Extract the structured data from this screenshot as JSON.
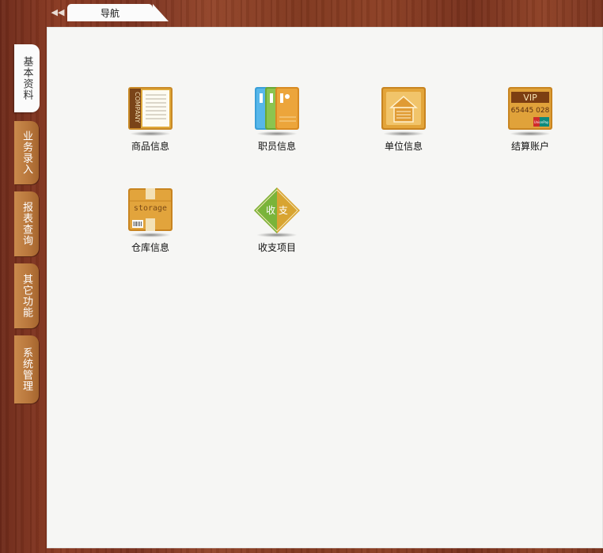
{
  "header": {
    "collapse_glyph": "◀◀",
    "nav_tab_label": "导航"
  },
  "sidebar": {
    "tabs": [
      {
        "label": "基本资料",
        "active": true
      },
      {
        "label": "业务录入",
        "active": false
      },
      {
        "label": "报表查询",
        "active": false
      },
      {
        "label": "其它功能",
        "active": false
      },
      {
        "label": "系统管理",
        "active": false
      }
    ]
  },
  "main": {
    "tiles": [
      {
        "label": "商品信息",
        "icon": "company-book-icon",
        "icon_text": "COMPANY"
      },
      {
        "label": "职员信息",
        "icon": "staff-cards-icon"
      },
      {
        "label": "单位信息",
        "icon": "warehouse-unit-icon"
      },
      {
        "label": "结算账户",
        "icon": "vip-card-icon",
        "icon_text": "VIP",
        "icon_number": "65445 028",
        "icon_brand": "UnionPay"
      },
      {
        "label": "仓库信息",
        "icon": "storage-box-icon",
        "icon_text": "storage"
      },
      {
        "label": "收支项目",
        "icon": "income-expense-diamond-icon",
        "icon_text": "收 支"
      }
    ]
  },
  "colors": {
    "wood": "#80381f",
    "tab_orange": "#b8773c",
    "panel": "#f6f6f4",
    "icon_gold": "#d79a2a"
  }
}
